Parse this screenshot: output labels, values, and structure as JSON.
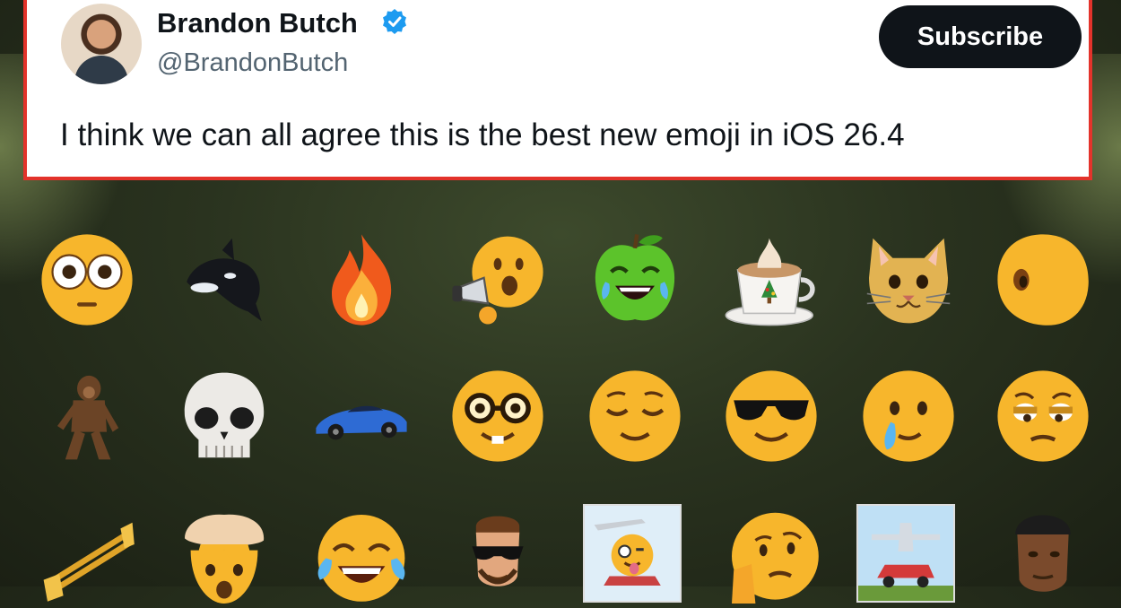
{
  "tweet": {
    "author_name": "Brandon Butch",
    "author_handle": "@BrandonButch",
    "subscribe_label": "Subscribe",
    "text": "I think we can all agree this is the best new emoji in iOS 26.4"
  },
  "colors": {
    "highlight_border": "#e3332b",
    "verified_blue": "#1d9bf0",
    "subscribe_bg": "#0f1419"
  },
  "emoji_grid": {
    "row1": [
      "flushed-face-icon",
      "orca-icon",
      "fire-icon",
      "face-with-megaphone-icon",
      "crying-laughing-apple-icon",
      "coffee-cup-christmas-tree-icon",
      "cat-face-icon",
      "distorted-face-icon"
    ],
    "row2": [
      "bigfoot-icon",
      "skull-icon",
      "sports-car-icon",
      "nerd-face-icon",
      "relieved-face-icon",
      "sunglasses-face-icon",
      "tear-face-icon",
      "tired-face-icon"
    ],
    "row3": [
      "trombone-icon",
      "exploding-head-icon",
      "tears-of-joy-face-icon",
      "man-with-sunglasses-icon",
      "airplane-car-face-sticker-icon",
      "thinking-face-icon",
      "airplane-car-sticker-icon",
      "person-beanie-icon"
    ]
  }
}
